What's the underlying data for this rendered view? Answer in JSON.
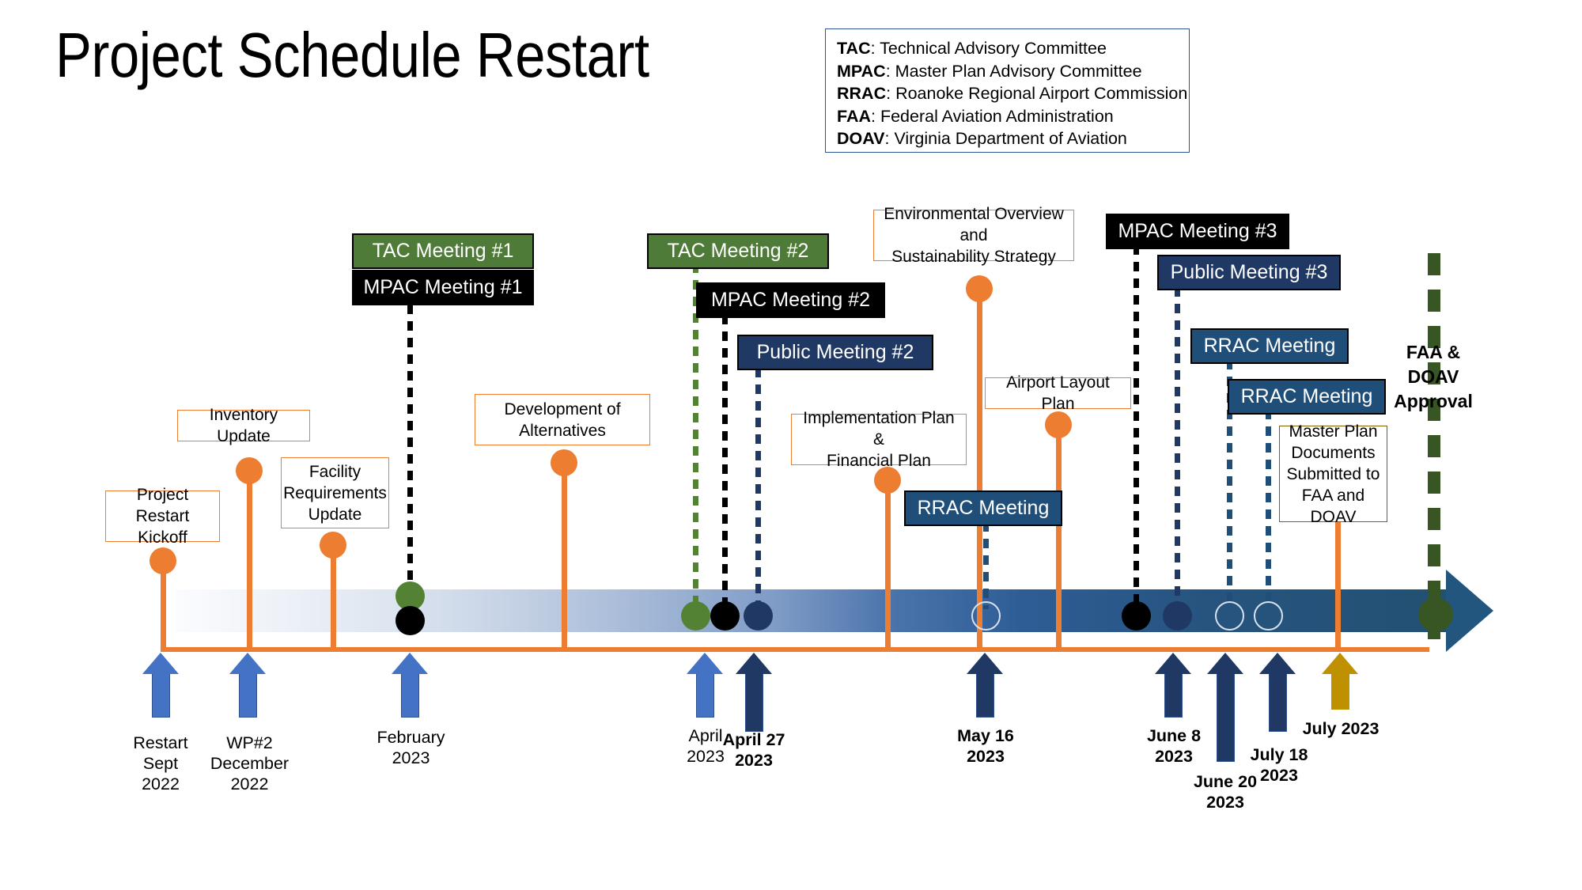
{
  "title": "Project Schedule Restart",
  "legend": {
    "rows": [
      {
        "abbr": "TAC",
        "sep": ": ",
        "text": "Technical Advisory Committee"
      },
      {
        "abbr": "MPAC",
        "sep": ": ",
        "text": "Master Plan Advisory Committee"
      },
      {
        "abbr": "RRAC",
        "sep": ": ",
        "text": "Roanoke Regional  Airport Commission"
      },
      {
        "abbr": "FAA",
        "sep": ": ",
        "text": "Federal Aviation Administration"
      },
      {
        "abbr": "DOAV",
        "sep": ": ",
        "text": "Virginia Department of Aviation"
      }
    ]
  },
  "callouts": [
    {
      "name": "project-restart-kickoff",
      "label": "Project Restart\nKickoff"
    },
    {
      "name": "inventory-update",
      "label": "Inventory Update"
    },
    {
      "name": "facility-requirements-update",
      "label": "Facility\nRequirements\nUpdate"
    },
    {
      "name": "development-of-alternatives",
      "label": "Development of\nAlternatives"
    },
    {
      "name": "implementation-financial-plan",
      "label": "Implementation Plan &\nFinancial Plan"
    },
    {
      "name": "environmental-overview",
      "label": "Environmental Overview and\nSustainability Strategy"
    },
    {
      "name": "airport-layout-plan",
      "label": "Airport Layout Plan"
    },
    {
      "name": "master-plan-documents",
      "label": "Master Plan\nDocuments\nSubmitted to\nFAA and DOAV"
    }
  ],
  "meetings": [
    {
      "name": "tac-meeting-1",
      "label": "TAC Meeting #1",
      "style": "green"
    },
    {
      "name": "mpac-meeting-1",
      "label": "MPAC Meeting #1",
      "style": "black"
    },
    {
      "name": "tac-meeting-2",
      "label": "TAC Meeting #2",
      "style": "green"
    },
    {
      "name": "mpac-meeting-2",
      "label": "MPAC Meeting #2",
      "style": "black"
    },
    {
      "name": "public-meeting-2",
      "label": "Public Meeting #2",
      "style": "navy"
    },
    {
      "name": "rrac-meeting-may",
      "label": "RRAC Meeting",
      "style": "steel"
    },
    {
      "name": "mpac-meeting-3",
      "label": "MPAC Meeting #3",
      "style": "black"
    },
    {
      "name": "public-meeting-3",
      "label": "Public Meeting #3",
      "style": "navy"
    },
    {
      "name": "rrac-meeting-june20",
      "label": "RRAC Meeting",
      "style": "steel"
    },
    {
      "name": "rrac-meeting-july18",
      "label": "RRAC Meeting",
      "style": "steel"
    }
  ],
  "approval": {
    "label": "FAA &\nDOAV\nApproval"
  },
  "dates": [
    {
      "name": "restart-sept-2022",
      "label": "Restart\nSept\n2022",
      "bold": false
    },
    {
      "name": "wp2-december-2022",
      "label": "WP#2\nDecember\n2022",
      "bold": false
    },
    {
      "name": "february-2023",
      "label": "February\n2023",
      "bold": false
    },
    {
      "name": "april-2023",
      "label": "April\n2023",
      "bold": false
    },
    {
      "name": "april-27-2023",
      "label": "April 27\n2023",
      "bold": true
    },
    {
      "name": "may-16-2023",
      "label": "May 16\n2023",
      "bold": true
    },
    {
      "name": "june-8-2023",
      "label": "June 8\n2023",
      "bold": true
    },
    {
      "name": "june-20-2023",
      "label": "June 20\n2023",
      "bold": true
    },
    {
      "name": "july-18-2023",
      "label": "July 18\n2023",
      "bold": true
    },
    {
      "name": "july-2023",
      "label": "July 2023",
      "bold": true
    }
  ],
  "colors": {
    "orange": "#ED7D31",
    "green": "#548235",
    "dark_green": "#375623",
    "navy": "#1F3864",
    "steel_blue": "#1F4E79",
    "light_blue_arrow": "#4472C4",
    "gold": "#BF9000",
    "chip_green": "#4F7B38",
    "legend_border": "#2E5496"
  },
  "chart_data": {
    "type": "timeline",
    "title": "Project Schedule Restart",
    "axis_orientation": "horizontal",
    "axis_direction": "left-to-right arrow",
    "axis_range": [
      "Sept 2022",
      "July 2023"
    ],
    "milestones": [
      {
        "date_label": "Restart Sept 2022",
        "bold": false,
        "arrow_color": "#4472C4",
        "callouts": [
          "Project Restart Kickoff"
        ],
        "meetings": [],
        "bar_markers": []
      },
      {
        "date_label": "WP#2 December 2022",
        "bold": false,
        "arrow_color": "#4472C4",
        "callouts": [
          "Inventory Update",
          "Facility Requirements Update"
        ],
        "meetings": [],
        "bar_markers": []
      },
      {
        "date_label": "February 2023",
        "bold": false,
        "arrow_color": "#4472C4",
        "callouts": [
          "Development of Alternatives"
        ],
        "meetings": [
          "TAC Meeting #1",
          "MPAC Meeting #1"
        ],
        "bar_markers": [
          "green",
          "black"
        ]
      },
      {
        "date_label": "April 2023",
        "bold": false,
        "arrow_color": "#4472C4",
        "callouts": [],
        "meetings": [
          "TAC Meeting #2"
        ],
        "bar_markers": [
          "green"
        ]
      },
      {
        "date_label": "April 27 2023",
        "bold": true,
        "arrow_color": "#1F3864",
        "callouts": [],
        "meetings": [
          "MPAC Meeting #2",
          "Public Meeting #2"
        ],
        "bar_markers": [
          "black",
          "navy"
        ]
      },
      {
        "date_label": "May 16 2023",
        "bold": true,
        "arrow_color": "#1F3864",
        "callouts": [
          "Implementation Plan & Financial Plan",
          "Environmental Overview and Sustainability Strategy",
          "Airport Layout Plan"
        ],
        "meetings": [
          "RRAC Meeting"
        ],
        "bar_markers": [
          "hollow"
        ]
      },
      {
        "date_label": "June 8 2023",
        "bold": true,
        "arrow_color": "#1F3864",
        "callouts": [],
        "meetings": [
          "MPAC Meeting #3",
          "Public Meeting #3"
        ],
        "bar_markers": [
          "black",
          "navy"
        ]
      },
      {
        "date_label": "June 20 2023",
        "bold": true,
        "arrow_color": "#1F3864",
        "callouts": [],
        "meetings": [
          "RRAC Meeting"
        ],
        "bar_markers": [
          "hollow"
        ]
      },
      {
        "date_label": "July 18 2023",
        "bold": true,
        "arrow_color": "#1F3864",
        "callouts": [],
        "meetings": [
          "RRAC Meeting"
        ],
        "bar_markers": [
          "hollow"
        ]
      },
      {
        "date_label": "July 2023",
        "bold": true,
        "arrow_color": "#BF9000",
        "callouts": [
          "Master Plan Documents Submitted to FAA and DOAV"
        ],
        "meetings": [],
        "bar_markers": []
      },
      {
        "date_label": "FAA & DOAV Approval",
        "bold": true,
        "arrow_color": null,
        "callouts": [],
        "meetings": [],
        "bar_markers": [
          "dark-green"
        ]
      }
    ]
  }
}
